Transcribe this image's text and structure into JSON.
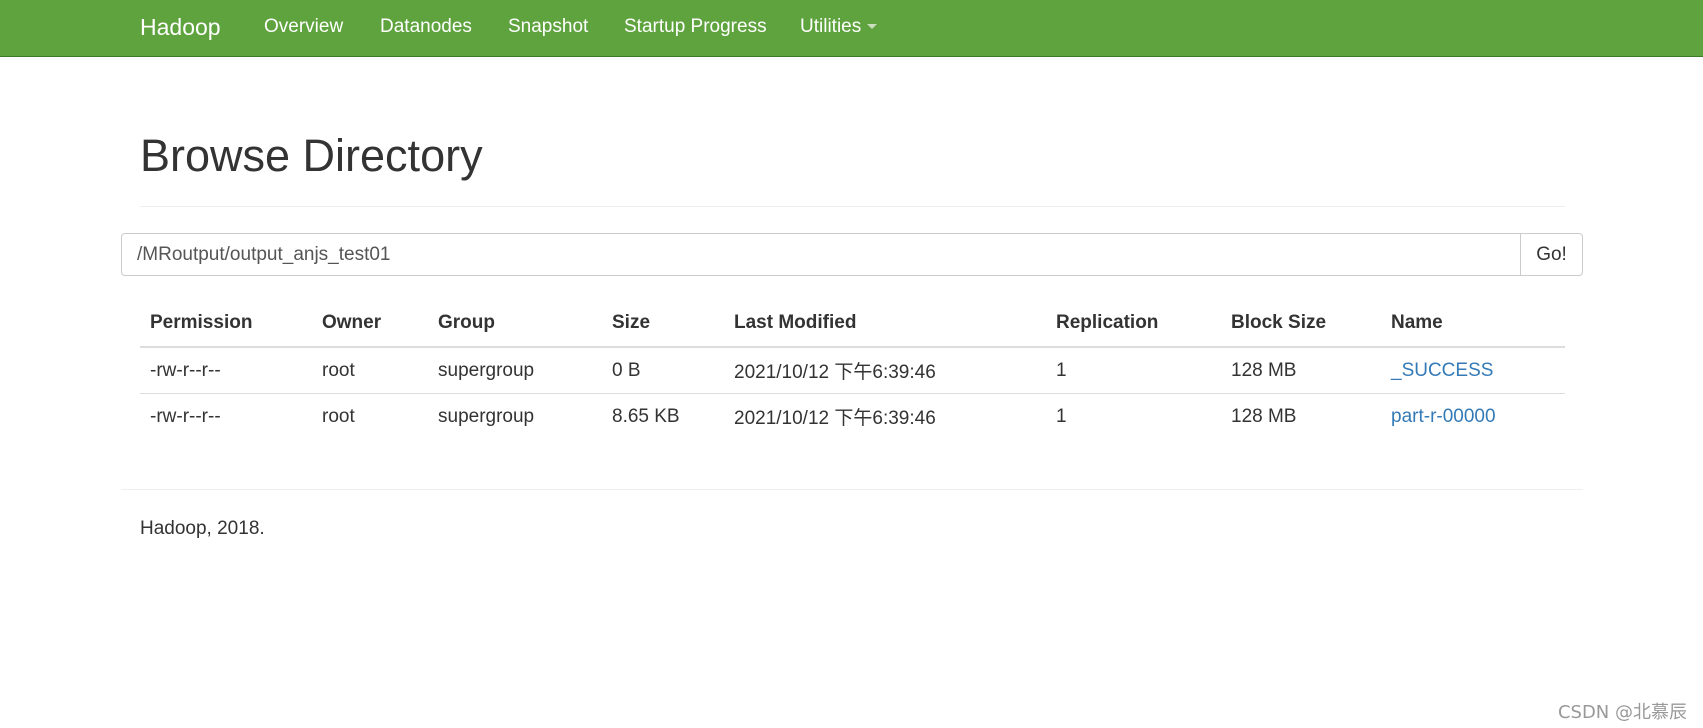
{
  "navbar": {
    "brand": "Hadoop",
    "items": [
      {
        "label": "Overview"
      },
      {
        "label": "Datanodes"
      },
      {
        "label": "Snapshot"
      },
      {
        "label": "Startup Progress"
      },
      {
        "label": "Utilities",
        "has_dropdown": true
      }
    ],
    "background_color": "#5fa33e"
  },
  "page": {
    "title": "Browse Directory"
  },
  "search": {
    "path_value": "/MRoutput/output_anjs_test01",
    "go_label": "Go!"
  },
  "table": {
    "headers": [
      "Permission",
      "Owner",
      "Group",
      "Size",
      "Last Modified",
      "Replication",
      "Block Size",
      "Name"
    ],
    "rows": [
      {
        "permission": "-rw-r--r--",
        "owner": "root",
        "group": "supergroup",
        "size": "0 B",
        "last_modified": "2021/10/12 下午6:39:46",
        "replication": "1",
        "block_size": "128 MB",
        "name": "_SUCCESS"
      },
      {
        "permission": "-rw-r--r--",
        "owner": "root",
        "group": "supergroup",
        "size": "8.65 KB",
        "last_modified": "2021/10/12 下午6:39:46",
        "replication": "1",
        "block_size": "128 MB",
        "name": "part-r-00000"
      }
    ],
    "link_color": "#337ab7"
  },
  "footer": {
    "text": "Hadoop, 2018."
  },
  "watermark": {
    "text": "CSDN @北慕辰"
  }
}
